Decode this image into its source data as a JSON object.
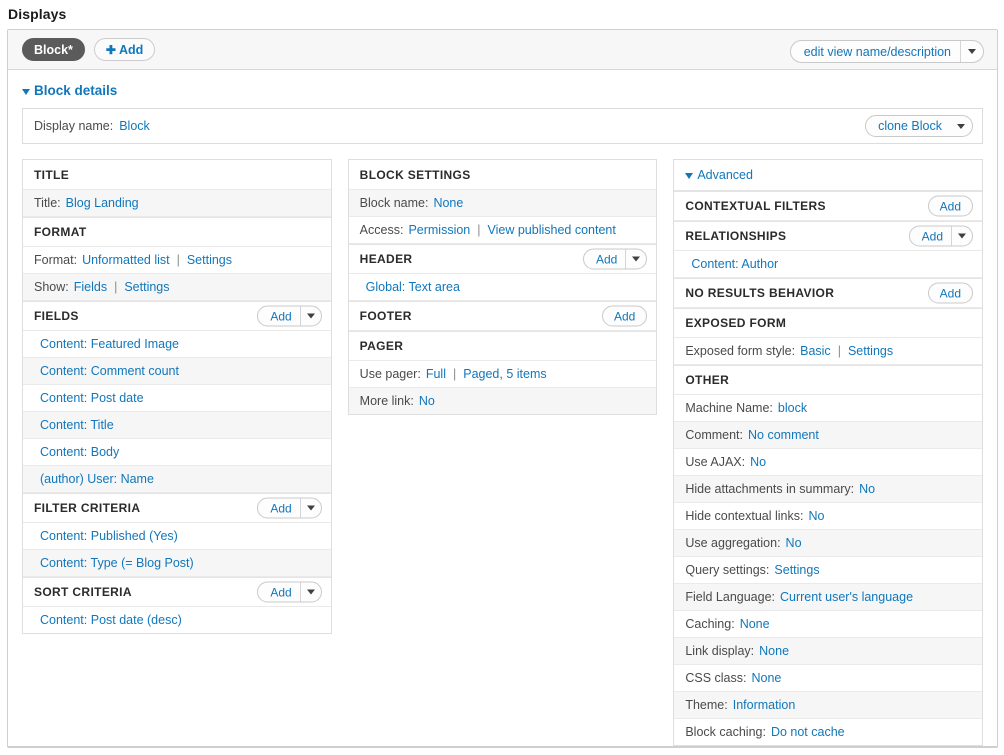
{
  "page": {
    "title": "Displays"
  },
  "tabs": {
    "display_tab": "Block*",
    "add_label": "Add",
    "add_icon": "plus-icon",
    "edit_view_label": "edit view name/description",
    "dropdown_icon": "chevron-down-icon"
  },
  "details": {
    "toggle_label": "Block details",
    "toggle_icon": "triangle-down-icon",
    "display_name_label": "Display name:",
    "display_name_value": "Block",
    "clone_label": "clone Block"
  },
  "columns": {
    "left": [
      {
        "bucket": "TITLE",
        "add": null,
        "rows": [
          {
            "label": "Title:",
            "links": [
              "Blog Landing"
            ],
            "shaded": true
          }
        ]
      },
      {
        "bucket": "FORMAT",
        "add": null,
        "rows": [
          {
            "label": "Format:",
            "links": [
              "Unformatted list",
              "Settings"
            ],
            "shaded": false
          },
          {
            "label": "Show:",
            "links": [
              "Fields",
              "Settings"
            ],
            "shaded": true
          }
        ]
      },
      {
        "bucket": "FIELDS",
        "add": {
          "label": "Add",
          "caret": true
        },
        "rows": [
          {
            "item": "Content: Featured Image",
            "shaded": false
          },
          {
            "item": "Content: Comment count",
            "shaded": true
          },
          {
            "item": "Content: Post date",
            "shaded": false
          },
          {
            "item": "Content: Title",
            "shaded": true
          },
          {
            "item": "Content: Body",
            "shaded": false
          },
          {
            "item": "(author) User: Name",
            "shaded": true
          }
        ]
      },
      {
        "bucket": "FILTER CRITERIA",
        "add": {
          "label": "Add",
          "caret": true
        },
        "rows": [
          {
            "item": "Content: Published (Yes)",
            "shaded": false
          },
          {
            "item": "Content: Type (= Blog Post)",
            "shaded": true
          }
        ]
      },
      {
        "bucket": "SORT CRITERIA",
        "add": {
          "label": "Add",
          "caret": true
        },
        "rows": [
          {
            "item": "Content: Post date (desc)",
            "shaded": false
          }
        ]
      }
    ],
    "middle": [
      {
        "bucket": "BLOCK SETTINGS",
        "add": null,
        "rows": [
          {
            "label": "Block name:",
            "links": [
              "None"
            ],
            "shaded": true
          },
          {
            "label": "Access:",
            "links": [
              "Permission",
              "View published content"
            ],
            "shaded": false
          }
        ]
      },
      {
        "bucket": "HEADER",
        "add": {
          "label": "Add",
          "caret": true
        },
        "rows": [
          {
            "item": "Global: Text area",
            "shaded": false
          }
        ]
      },
      {
        "bucket": "FOOTER",
        "add": {
          "label": "Add",
          "caret": false
        },
        "rows": []
      },
      {
        "bucket": "PAGER",
        "add": null,
        "rows": [
          {
            "label": "Use pager:",
            "links": [
              "Full",
              "Paged, 5 items"
            ],
            "shaded": false
          },
          {
            "label": "More link:",
            "links": [
              "No"
            ],
            "shaded": true
          }
        ]
      }
    ],
    "right": [
      {
        "bucket": "CONTEXTUAL FILTERS",
        "add": {
          "label": "Add",
          "caret": false
        },
        "rows": []
      },
      {
        "bucket": "RELATIONSHIPS",
        "add": {
          "label": "Add",
          "caret": true
        },
        "rows": [
          {
            "item": "Content: Author",
            "shaded": false
          }
        ]
      },
      {
        "bucket": "NO RESULTS BEHAVIOR",
        "add": {
          "label": "Add",
          "caret": false
        },
        "rows": []
      },
      {
        "bucket": "EXPOSED FORM",
        "add": null,
        "rows": [
          {
            "label": "Exposed form style:",
            "links": [
              "Basic",
              "Settings"
            ],
            "shaded": false
          }
        ]
      },
      {
        "bucket": "OTHER",
        "add": null,
        "rows": [
          {
            "label": "Machine Name:",
            "links": [
              "block"
            ],
            "shaded": false
          },
          {
            "label": "Comment:",
            "links": [
              "No comment"
            ],
            "shaded": true
          },
          {
            "label": "Use AJAX:",
            "links": [
              "No"
            ],
            "shaded": false
          },
          {
            "label": "Hide attachments in summary:",
            "links": [
              "No"
            ],
            "shaded": true
          },
          {
            "label": "Hide contextual links:",
            "links": [
              "No"
            ],
            "shaded": false
          },
          {
            "label": "Use aggregation:",
            "links": [
              "No"
            ],
            "shaded": true
          },
          {
            "label": "Query settings:",
            "links": [
              "Settings"
            ],
            "shaded": false
          },
          {
            "label": "Field Language:",
            "links": [
              "Current user's language"
            ],
            "shaded": true
          },
          {
            "label": "Caching:",
            "links": [
              "None"
            ],
            "shaded": false
          },
          {
            "label": "Link display:",
            "links": [
              "None"
            ],
            "shaded": true
          },
          {
            "label": "CSS class:",
            "links": [
              "None"
            ],
            "shaded": false
          },
          {
            "label": "Theme:",
            "links": [
              "Information"
            ],
            "shaded": true
          },
          {
            "label": "Block caching:",
            "links": [
              "Do not cache"
            ],
            "shaded": false
          }
        ]
      }
    ]
  },
  "advanced": {
    "label": "Advanced",
    "icon": "triangle-down-icon"
  },
  "colors": {
    "link": "#1177bb",
    "active_tab_bg": "#5b5b5b",
    "row_shade": "#f6f6f6",
    "border": "#dedede"
  }
}
